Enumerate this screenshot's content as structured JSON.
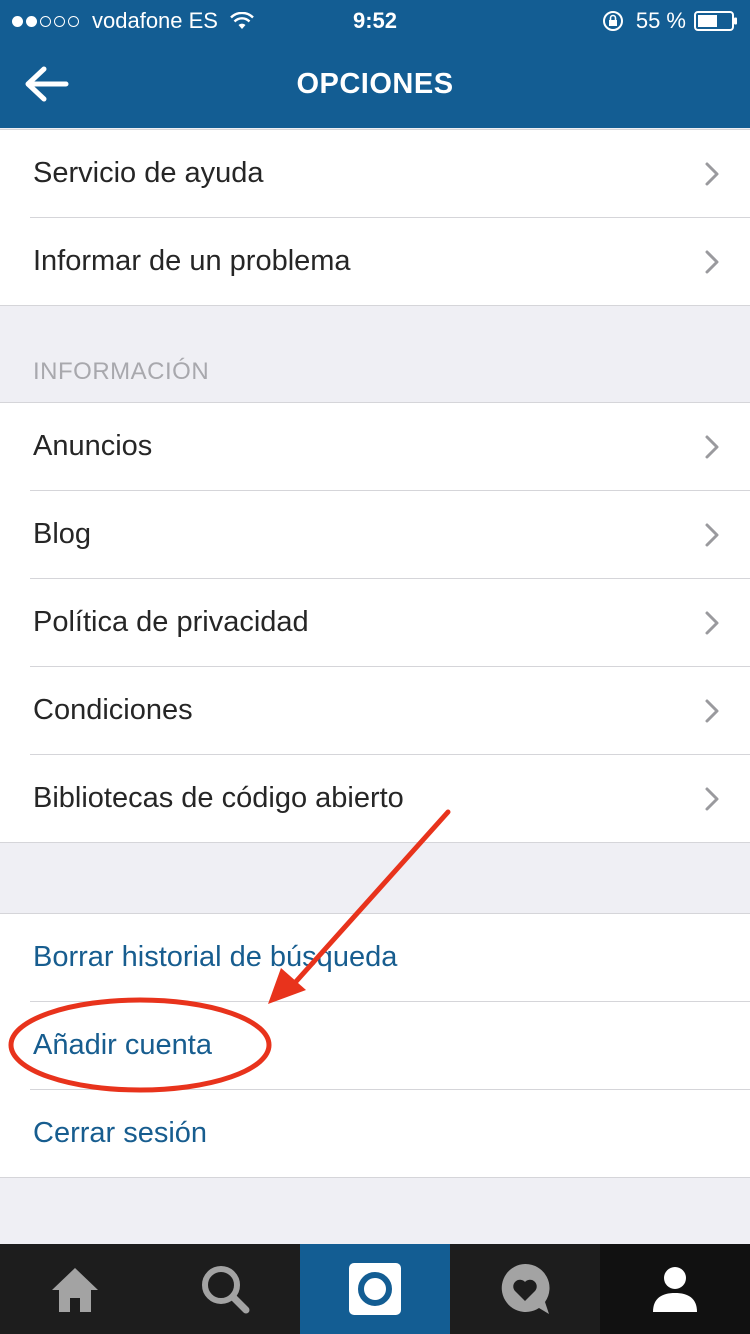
{
  "status_bar": {
    "carrier": "vodafone ES",
    "time": "9:52",
    "battery": "55 %",
    "signal_bars_filled": 2,
    "signal_bars_total": 5
  },
  "header": {
    "title": "OPCIONES",
    "back_icon": "arrow-left-icon"
  },
  "support_group": [
    {
      "label": "Servicio de ayuda"
    },
    {
      "label": "Informar de un problema"
    }
  ],
  "info_section": {
    "title": "INFORMACIÓN",
    "items": [
      {
        "label": "Anuncios"
      },
      {
        "label": "Blog"
      },
      {
        "label": "Política de privacidad"
      },
      {
        "label": "Condiciones"
      },
      {
        "label": "Bibliotecas de código abierto"
      }
    ]
  },
  "account_group": [
    {
      "label": "Borrar historial de búsqueda"
    },
    {
      "label": "Añadir cuenta"
    },
    {
      "label": "Cerrar sesión"
    }
  ],
  "tab_bar": [
    {
      "icon": "home-icon"
    },
    {
      "icon": "search-icon"
    },
    {
      "icon": "camera-icon",
      "active": true
    },
    {
      "icon": "activity-heart-icon"
    },
    {
      "icon": "profile-icon"
    }
  ],
  "colors": {
    "header_bg": "#135d93",
    "link_text": "#175d8f",
    "annotation": "#e8331c"
  }
}
